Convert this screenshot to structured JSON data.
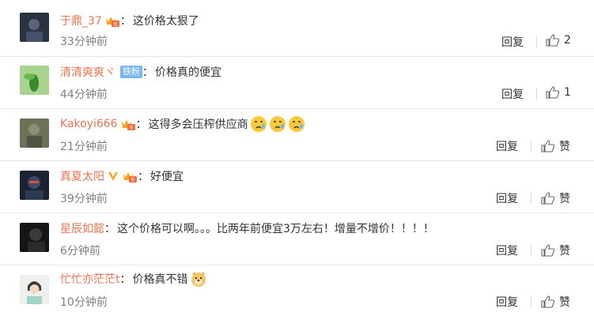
{
  "comments": [
    {
      "username": "于鼎_37",
      "separator": "：",
      "text": "这价格太狠了",
      "time": "33分钟前",
      "reply": "回复",
      "likes": "2"
    },
    {
      "username": "清清爽爽ヾ",
      "fan_badge": "铁粉",
      "separator": "：",
      "text": "价格真的便宜",
      "time": "44分钟前",
      "reply": "回复",
      "likes": "1"
    },
    {
      "username": "Kakoyi666",
      "separator": "：",
      "text": "这得多会压榨供应商",
      "time": "21分钟前",
      "reply": "回复",
      "likes": "赞"
    },
    {
      "username": "真夏太阳",
      "separator": "：",
      "text": "好便宜",
      "time": "39分钟前",
      "reply": "回复",
      "likes": "赞"
    },
    {
      "username": "星辰如懿",
      "separator": "：",
      "text": "这个价格可以啊。。。比两年前便宜3万左右！增量不增价！！！！",
      "time": "6分钟前",
      "reply": "回复",
      "likes": "赞"
    },
    {
      "username": "忙忙亦茫茫t",
      "separator": "：",
      "text": "价格真不错",
      "time": "10分钟前",
      "reply": "回复",
      "likes": "赞"
    }
  ],
  "colors": {
    "username": "#eb7350",
    "time": "#808080",
    "divider": "#e6e6e6"
  }
}
